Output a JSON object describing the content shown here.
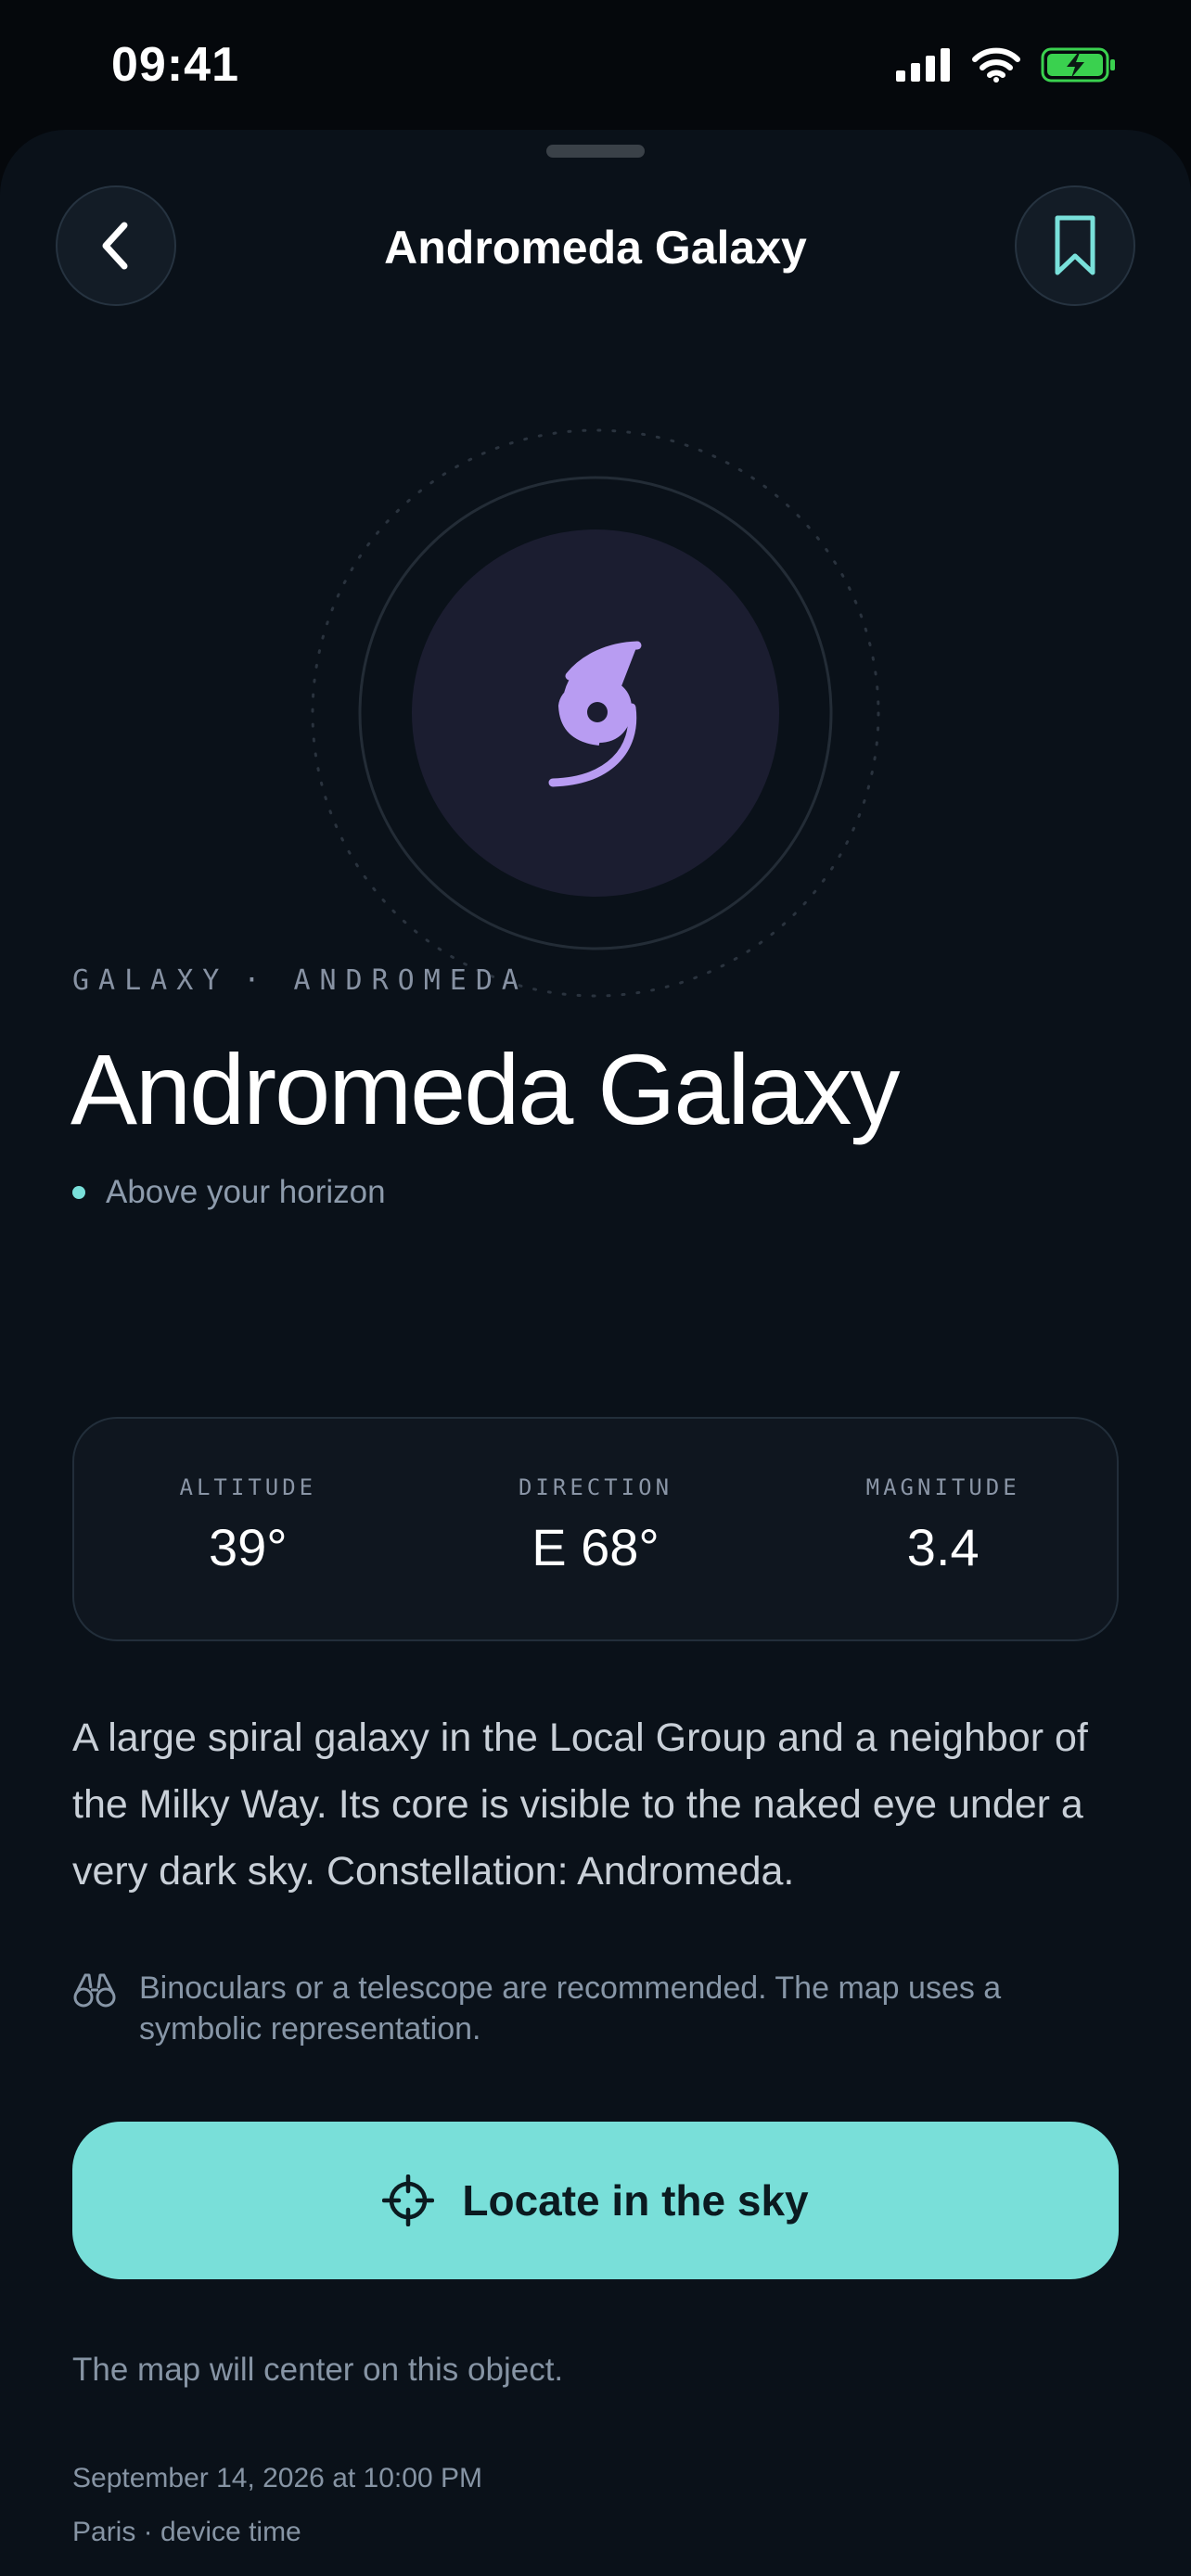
{
  "status_bar": {
    "time": "09:41",
    "battery_color": "#3ad14f"
  },
  "header": {
    "title": "Andromeda Galaxy"
  },
  "hero": {
    "icon": "spiral-galaxy-icon",
    "accent_color": "#b89cf2"
  },
  "object": {
    "kicker_type": "GALAXY",
    "kicker_separator": "·",
    "kicker_constellation": "ANDROMEDA",
    "name": "Andromeda Galaxy",
    "visibility": "Above your horizon",
    "visibility_color": "#79e0da"
  },
  "stats": [
    {
      "label": "ALTITUDE",
      "value": "39°"
    },
    {
      "label": "DIRECTION",
      "value": "E 68°"
    },
    {
      "label": "MAGNITUDE",
      "value": "3.4"
    }
  ],
  "description": "A large spiral galaxy in the Local Group and a neighbor of the Milky Way. Its core is visible to the naked eye under a very dark sky. Constellation: Andromeda.",
  "note": {
    "icon": "binoculars-icon",
    "text": "Binoculars or a telescope are recommended. The map uses a symbolic representation."
  },
  "action": {
    "label": "Locate in the sky",
    "icon": "crosshair-icon",
    "color": "#79dfd9"
  },
  "hint": "The map will center on this object.",
  "footer": {
    "date": "September 14, 2026 at 10:00 PM",
    "place": "Paris · device time"
  }
}
